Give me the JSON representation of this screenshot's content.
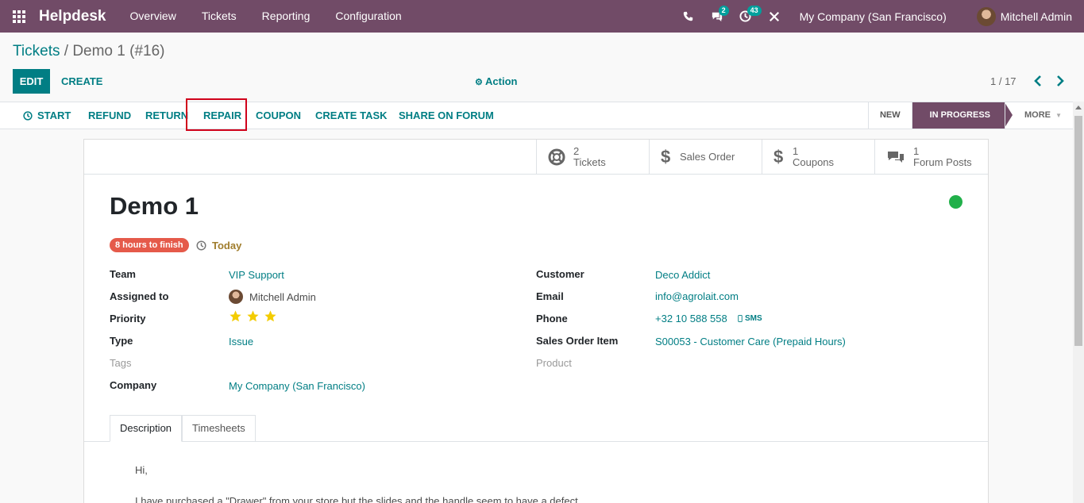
{
  "navbar": {
    "app_name": "Helpdesk",
    "menu": [
      "Overview",
      "Tickets",
      "Reporting",
      "Configuration"
    ],
    "messages_count": "2",
    "activities_count": "43",
    "company": "My Company (San Francisco)",
    "user": "Mitchell Admin"
  },
  "breadcrumb": {
    "parent": "Tickets",
    "separator": " / ",
    "current": "Demo 1 (#16)"
  },
  "controls": {
    "edit": "EDIT",
    "create": "CREATE",
    "action": "Action",
    "pager": "1 / 17"
  },
  "statusbar": {
    "buttons": [
      "START",
      "REFUND",
      "RETURN",
      "REPAIR",
      "COUPON",
      "CREATE TASK",
      "SHARE ON FORUM"
    ],
    "stages": [
      "NEW",
      "IN PROGRESS",
      "MORE"
    ]
  },
  "smart_buttons": [
    {
      "icon": "lifebuoy-icon",
      "value": "2",
      "label": "Tickets"
    },
    {
      "icon": "dollar-icon",
      "value": "",
      "label": "Sales Order"
    },
    {
      "icon": "dollar-icon",
      "value": "1",
      "label": "Coupons"
    },
    {
      "icon": "comments-icon",
      "value": "1",
      "label": "Forum Posts"
    }
  ],
  "ticket": {
    "title": "Demo 1",
    "deadline": "8 hours to finish",
    "due": "Today",
    "status_color": "#21b04a"
  },
  "fields_left": {
    "team_label": "Team",
    "team": "VIP Support",
    "assigned_label": "Assigned to",
    "assigned": "Mitchell Admin",
    "priority_label": "Priority",
    "priority_stars": 3,
    "type_label": "Type",
    "type": "Issue",
    "tags_label": "Tags",
    "company_label": "Company",
    "company": "My Company (San Francisco)"
  },
  "fields_right": {
    "customer_label": "Customer",
    "customer": "Deco Addict",
    "email_label": "Email",
    "email": "info@agrolait.com",
    "phone_label": "Phone",
    "phone": "+32 10 588 558",
    "sms": "SMS",
    "so_item_label": "Sales Order Item",
    "so_item": "S00053 - Customer Care (Prepaid Hours)",
    "product_label": "Product"
  },
  "tabs": [
    "Description",
    "Timesheets"
  ],
  "description": {
    "line1": "Hi,",
    "line2": "I have purchased a \"Drawer\" from your store but the slides and the handle seem to have a defect."
  },
  "colors": {
    "primary": "#714b67",
    "accent": "#017e84",
    "danger": "#e55a4a",
    "highlight": "#d0021b"
  }
}
